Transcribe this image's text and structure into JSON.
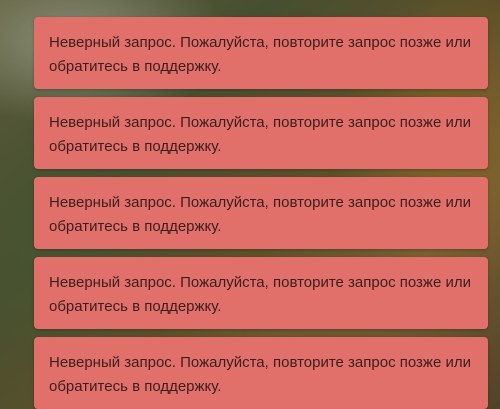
{
  "notifications": [
    {
      "message": "Неверный запрос. Пожалуйста, повторите запрос позже или обратитесь в поддержку."
    },
    {
      "message": "Неверный запрос. Пожалуйста, повторите запрос позже или обратитесь в поддержку."
    },
    {
      "message": "Неверный запрос. Пожалуйста, повторите запрос позже или обратитесь в поддержку."
    },
    {
      "message": "Неверный запрос. Пожалуйста, повторите запрос позже или обратитесь в поддержку."
    },
    {
      "message": "Неверный запрос. Пожалуйста, повторите запрос позже или обратитесь в поддержку."
    }
  ],
  "colors": {
    "toast_background": "#e2706a",
    "toast_text": "#3a1f1f"
  }
}
